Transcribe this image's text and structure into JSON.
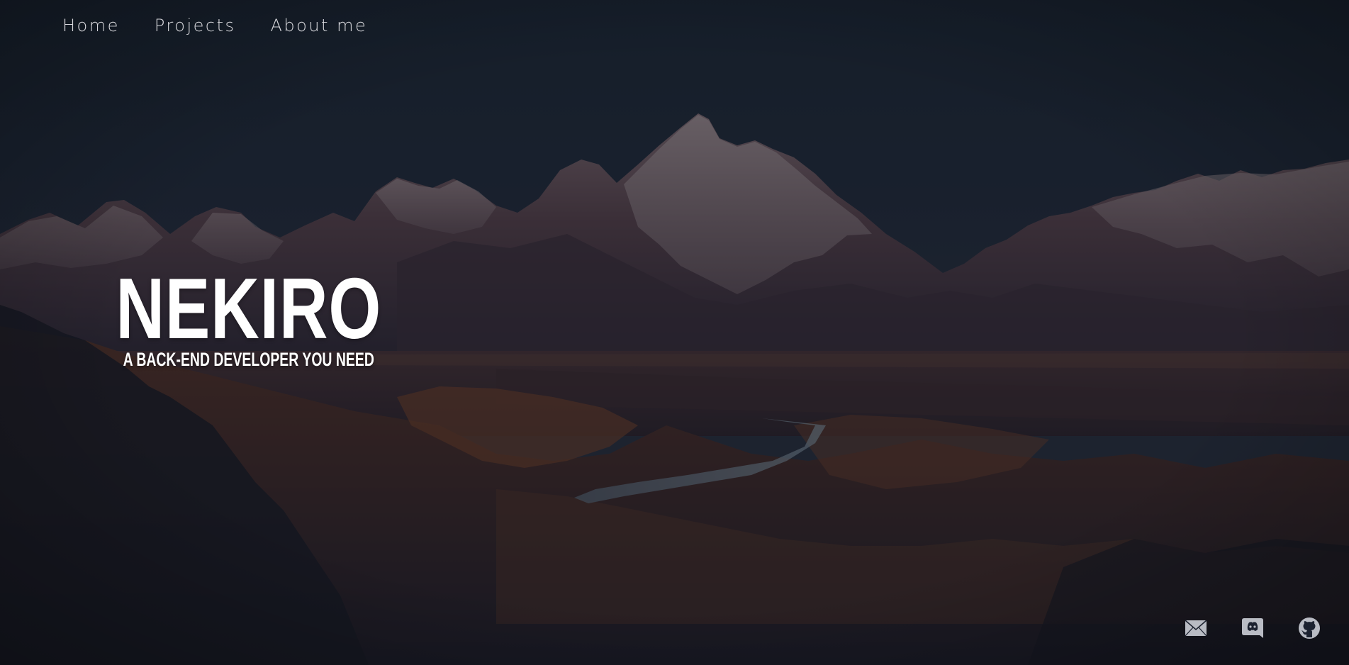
{
  "nav": {
    "items": [
      {
        "label": "Home"
      },
      {
        "label": "Projects"
      },
      {
        "label": "About me"
      }
    ]
  },
  "hero": {
    "name": "NEKIRO",
    "tagline": "A BACK-END DEVELOPER YOU NEED"
  },
  "social": {
    "icons": [
      "mail-icon",
      "discord-icon",
      "github-icon"
    ],
    "icon_color": "#b9bcc4"
  },
  "colors": {
    "sky": "#1b2533",
    "overlay": "#141a26",
    "text": "#ffffff"
  }
}
